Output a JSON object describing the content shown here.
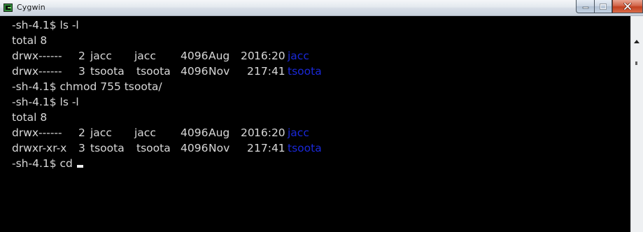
{
  "window": {
    "title": "Cygwin",
    "app_icon": "cygwin-icon",
    "caption_buttons": [
      "minimize-icon",
      "maximize-icon",
      "close-icon"
    ]
  },
  "terminal": {
    "lines": {
      "l1": {
        "cmd": "-sh-4.1$ ls -l"
      },
      "l2": {
        "cmd": "total 8"
      },
      "l3": {
        "perm": "drwx------",
        "links": "2",
        "owner": "jacc",
        "group": "jacc",
        "size": "4096",
        "month": "Aug",
        "day": "20",
        "time": "16:20",
        "name": "jacc"
      },
      "l4": {
        "perm": "drwx------",
        "links": "3",
        "owner": "tsoota",
        "group": "tsoota",
        "size": "4096",
        "month": "Nov",
        "day": "2",
        "time": "17:41",
        "name": "tsoota"
      },
      "l5": {
        "cmd": "-sh-4.1$ chmod 755 tsoota/"
      },
      "l6": {
        "cmd": "-sh-4.1$ ls -l"
      },
      "l7": {
        "cmd": "total 8"
      },
      "l8": {
        "perm": "drwx------",
        "links": "2",
        "owner": "jacc",
        "group": "jacc",
        "size": "4096",
        "month": "Aug",
        "day": "20",
        "time": "16:20",
        "name": "jacc"
      },
      "l9": {
        "perm": "drwxr-xr-x",
        "links": "3",
        "owner": "tsoota",
        "group": "tsoota",
        "size": "4096",
        "month": "Nov",
        "day": "2",
        "time": "17:41",
        "name": "tsoota"
      },
      "l10": {
        "cmd": "-sh-4.1$ cd "
      }
    },
    "colors": {
      "background": "#000000",
      "text": "#d8d8d8",
      "directory": "#1a28d8"
    }
  }
}
